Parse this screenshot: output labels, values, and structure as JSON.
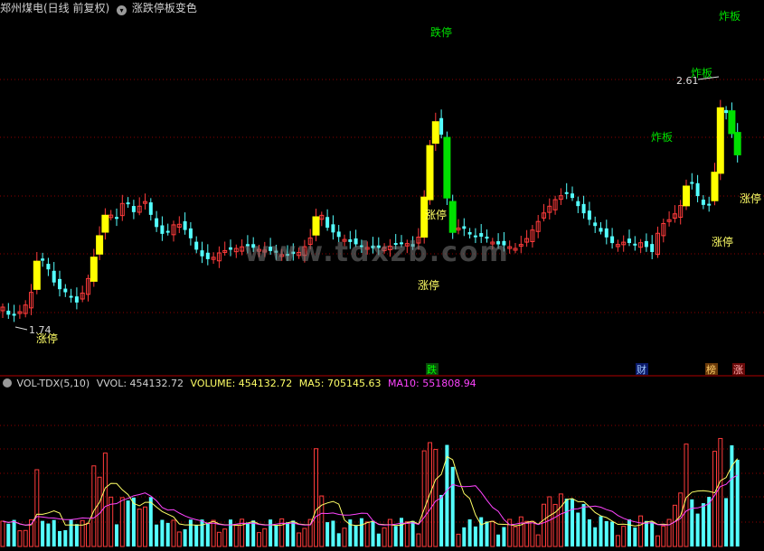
{
  "header": {
    "stock_title": "郑州煤电(日线 前复权)",
    "indicator_name": "涨跌停板变色"
  },
  "volume_header": {
    "indicator": "VOL-TDX(5,10)",
    "vvol": "VVOL: 454132.72",
    "volume": "VOLUME: 454132.72",
    "ma5": "MA5: 705145.63",
    "ma10": "MA10: 551808.94"
  },
  "watermark": "www.tdxzb.com",
  "colors": {
    "up": "#ff3b3b",
    "down": "#54ffff",
    "limit_up": "#ffff00",
    "limit_down": "#00e000",
    "grid": "#8b0000",
    "ma5": "#ffff66",
    "ma10": "#ff44ff"
  },
  "annotations": {
    "limit_up_1": "涨停",
    "limit_up_2": "涨停",
    "limit_up_3": "涨停",
    "limit_up_4": "涨停",
    "limit_up_5": "涨停",
    "limit_down": "跌停",
    "broken_1": "炸板",
    "broken_2": "炸板",
    "broken_3": "炸板",
    "price_low": "1.74",
    "price_high": "2.61"
  },
  "event_markers": {
    "die": "跌",
    "cai": "财",
    "bang": "榜",
    "zhang": "涨"
  }
}
